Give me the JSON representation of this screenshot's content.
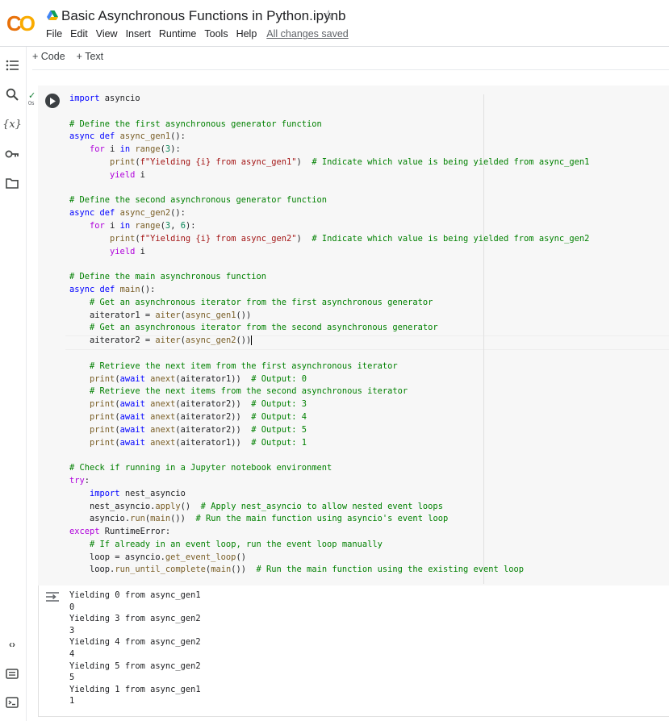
{
  "app": {
    "logo_text": "CO",
    "notebook_title": "Basic Asynchronous Functions in Python.ipynb"
  },
  "menu": {
    "items": [
      "File",
      "Edit",
      "View",
      "Insert",
      "Runtime",
      "Tools",
      "Help"
    ],
    "save_status": "All changes saved"
  },
  "toolbar": {
    "add_code": "+ Code",
    "add_text": "+ Text"
  },
  "rail": {
    "variables_label": "{x}"
  },
  "cell": {
    "status_check": "✓",
    "exec_time": "0s",
    "code_lines": [
      "import asyncio",
      "",
      "# Define the first asynchronous generator function",
      "async def async_gen1():",
      "    for i in range(3):",
      "        print(f\"Yielding {i} from async_gen1\")  # Indicate which value is being yielded from async_gen1",
      "        yield i",
      "",
      "# Define the second asynchronous generator function",
      "async def async_gen2():",
      "    for i in range(3, 6):",
      "        print(f\"Yielding {i} from async_gen2\")  # Indicate which value is being yielded from async_gen2",
      "        yield i",
      "",
      "# Define the main asynchronous function",
      "async def main():",
      "    # Get an asynchronous iterator from the first asynchronous generator",
      "    aiterator1 = aiter(async_gen1())",
      "    # Get an asynchronous iterator from the second asynchronous generator",
      "    aiterator2 = aiter(async_gen2())",
      "",
      "    # Retrieve the next item from the first asynchronous iterator",
      "    print(await anext(aiterator1))  # Output: 0",
      "    # Retrieve the next items from the second asynchronous iterator",
      "    print(await anext(aiterator2))  # Output: 3",
      "    print(await anext(aiterator2))  # Output: 4",
      "    print(await anext(aiterator2))  # Output: 5",
      "    print(await anext(aiterator1))  # Output: 1",
      "",
      "# Check if running in a Jupyter notebook environment",
      "try:",
      "    import nest_asyncio",
      "    nest_asyncio.apply()  # Apply nest_asyncio to allow nested event loops",
      "    asyncio.run(main())  # Run the main function using asyncio's event loop",
      "except RuntimeError:",
      "    # If already in an event loop, run the event loop manually",
      "    loop = asyncio.get_event_loop()",
      "    loop.run_until_complete(main())  # Run the main function using the existing event loop"
    ],
    "output_lines": [
      "Yielding 0 from async_gen1",
      "0",
      "Yielding 3 from async_gen2",
      "3",
      "Yielding 4 from async_gen2",
      "4",
      "Yielding 5 from async_gen2",
      "5",
      "Yielding 1 from async_gen1",
      "1"
    ]
  },
  "colors": {
    "logo_orange": "#e8710a",
    "logo_yellow": "#f9ab00",
    "keyword": "#0000ff",
    "control": "#af00db",
    "function": "#795e26",
    "string": "#a31515",
    "number": "#098658",
    "comment": "#008000",
    "check": "#188038"
  },
  "icons": {
    "drive": "google-drive-icon",
    "star": "star-icon",
    "toc": "table-of-contents-icon",
    "search": "search-icon",
    "variables": "variables-icon",
    "secrets": "key-icon",
    "files": "folder-icon",
    "code_snippets": "code-brackets-icon",
    "command_palette": "keyboard-icon",
    "terminal": "terminal-icon",
    "run": "play-icon",
    "output": "output-toggle-icon"
  }
}
